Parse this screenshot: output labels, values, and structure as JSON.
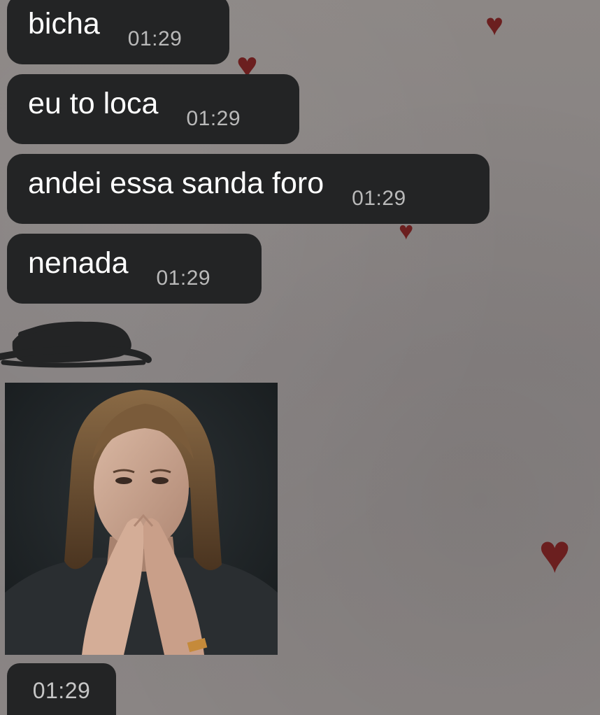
{
  "messages": [
    {
      "text": "bicha",
      "time": "01:29"
    },
    {
      "text": "eu to loca",
      "time": "01:29"
    },
    {
      "text": "andei essa sanda foro",
      "time": "01:29"
    },
    {
      "text": "nenada",
      "time": "01:29"
    }
  ],
  "image_message": {
    "time": "01:29"
  },
  "wallpaper": {
    "background": "#8a8583",
    "heart_color": "#6b1f1f",
    "bubble_color": "#232425"
  }
}
